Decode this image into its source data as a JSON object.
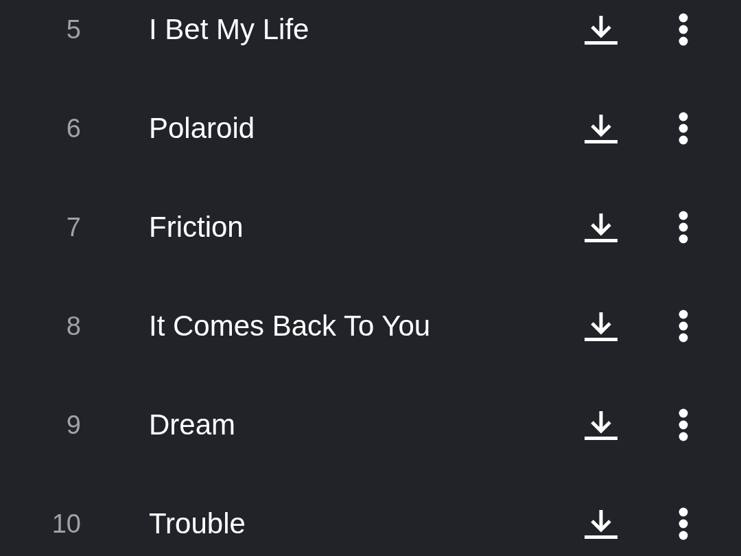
{
  "tracks": [
    {
      "number": "5",
      "title": "I Bet My Life"
    },
    {
      "number": "6",
      "title": "Polaroid"
    },
    {
      "number": "7",
      "title": "Friction"
    },
    {
      "number": "8",
      "title": "It Comes Back To You"
    },
    {
      "number": "9",
      "title": "Dream"
    },
    {
      "number": "10",
      "title": "Trouble"
    }
  ]
}
